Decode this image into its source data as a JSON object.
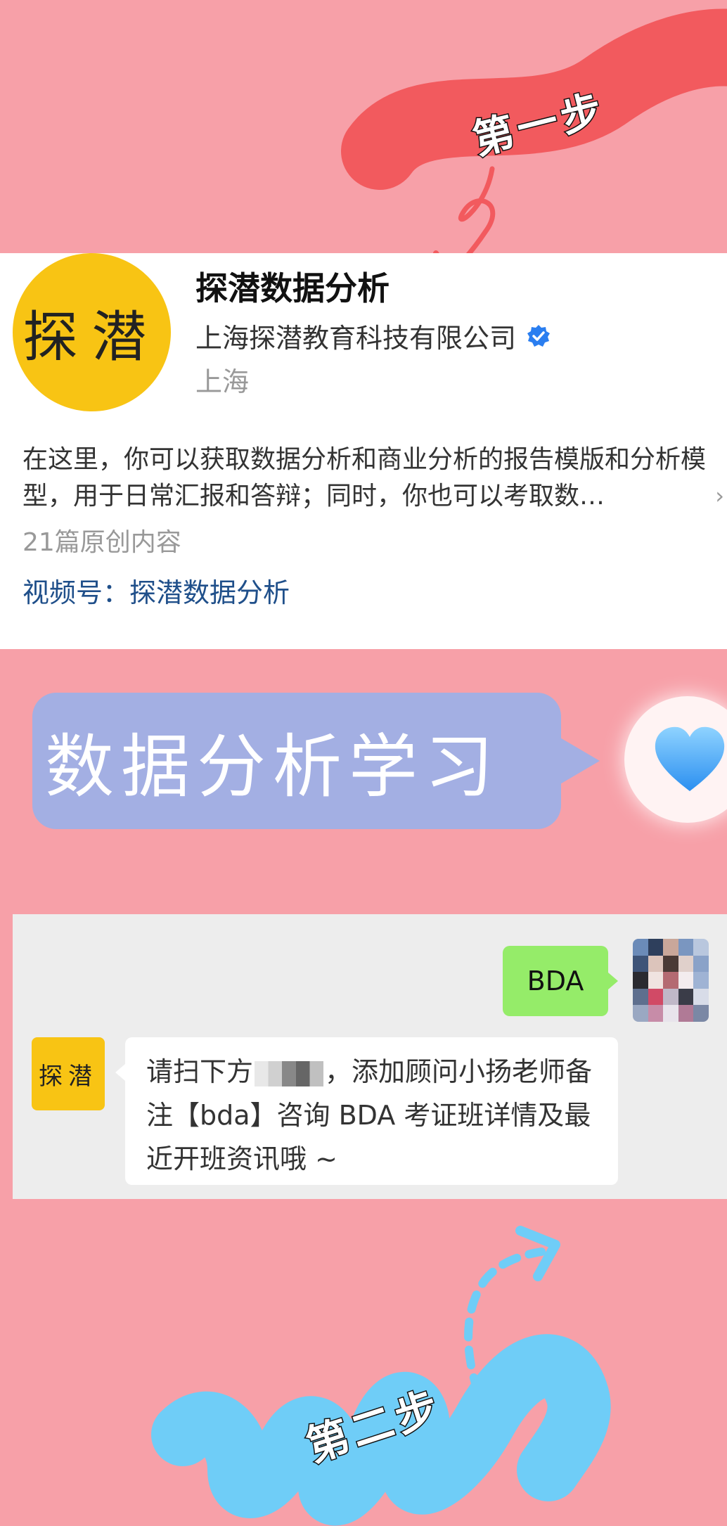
{
  "step1": {
    "label": "第一步"
  },
  "profile": {
    "avatar_text": "探潜",
    "account_name": "探潜数据分析",
    "company": "上海探潜教育科技有限公司",
    "location": "上海",
    "intro": "在这里，你可以获取数据分析和商业分析的报告模版和分析模型，用于日常汇报和答辩；同时，你也可以考取数…",
    "article_count": "21篇原创内容",
    "channel": "视频号：探潜数据分析"
  },
  "banner": {
    "text": "数据分析学习"
  },
  "chat": {
    "my_message": "BDA",
    "bot_avatar_text": "探潜",
    "bot_message_part1": "请扫下方",
    "bot_message_part2": "，添加顾问小扬老师备注【bda】咨询 BDA 考证班详情及最近开班资讯哦 ~"
  },
  "step2": {
    "label": "第二步"
  },
  "colors": {
    "background": "#f7a0a8",
    "step1_ribbon": "#f25a5e",
    "step2_ribbon": "#6fcdf7",
    "avatar_yellow": "#f8c414",
    "bubble_purple": "#a3afe3",
    "chat_green": "#95ec69"
  }
}
